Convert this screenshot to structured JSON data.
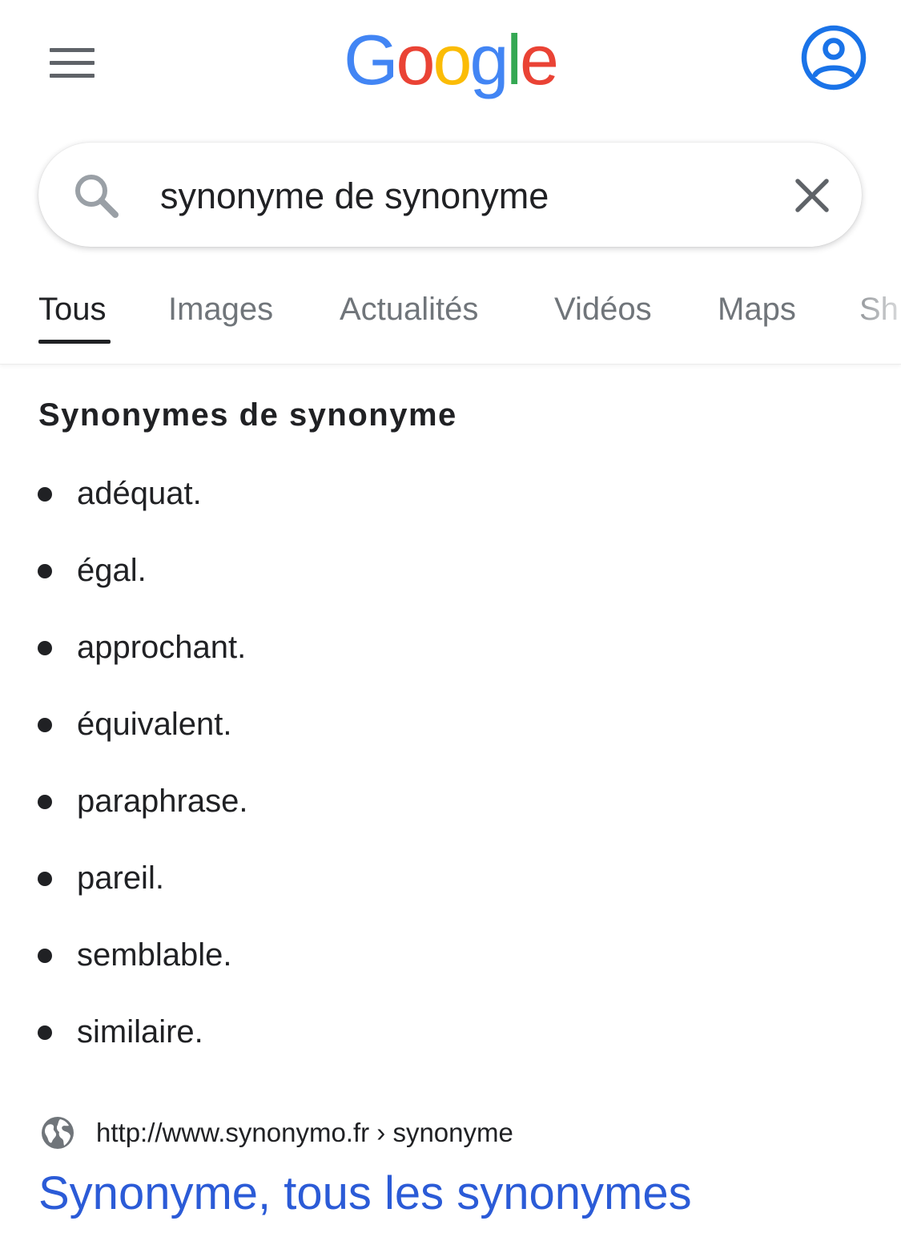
{
  "header": {
    "logo_text": "Google",
    "logo_colors": [
      "#4285F4",
      "#EA4335",
      "#FBBC05",
      "#4285F4",
      "#34A853",
      "#EA4335"
    ],
    "menu_icon": "hamburger-menu-icon",
    "account_icon": "account-circle-icon"
  },
  "search": {
    "query": "synonyme de synonyme",
    "search_icon": "magnifier-icon",
    "clear_icon": "close-icon"
  },
  "tabs": [
    {
      "label": "Tous",
      "active": true
    },
    {
      "label": "Images",
      "active": false
    },
    {
      "label": "Actualités",
      "active": false
    },
    {
      "label": "Vidéos",
      "active": false
    },
    {
      "label": "Maps",
      "active": false
    },
    {
      "label": "Sh",
      "active": false
    }
  ],
  "synonyms": {
    "title": "Synonymes de synonyme",
    "items": [
      "adéquat.",
      "égal.",
      "approchant.",
      "équivalent.",
      "paraphrase.",
      "pareil.",
      "semblable.",
      "similaire."
    ]
  },
  "result": {
    "url": "http://www.synonymo.fr › synonyme",
    "title": "Synonyme, tous les synonymes",
    "site_icon": "globe-icon",
    "link_color": "#2b5bd7"
  }
}
